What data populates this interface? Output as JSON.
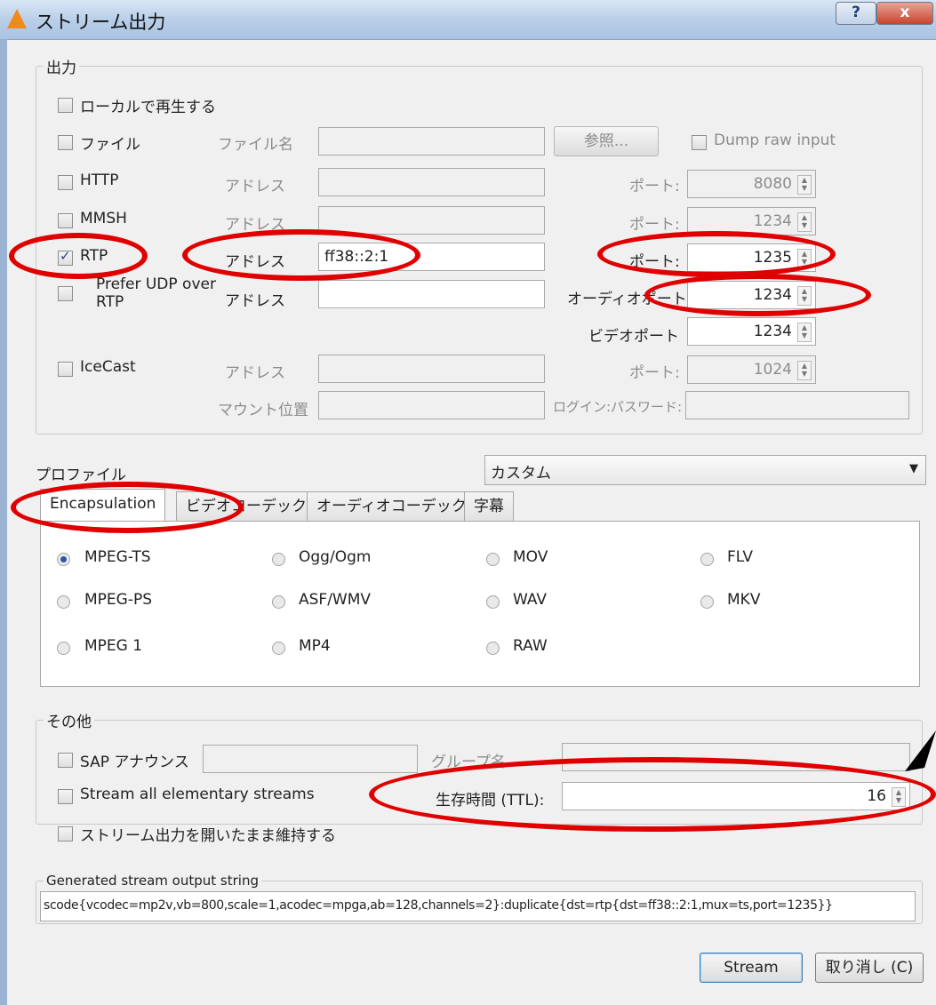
{
  "window": {
    "title": "ストリーム出力",
    "help": "?",
    "close": "x"
  },
  "output": {
    "legend": "出力",
    "local_play": "ローカルで再生する",
    "file": {
      "label": "ファイル",
      "name_label": "ファイル名",
      "name_value": "",
      "browse": "参照...",
      "dump_raw": "Dump raw input"
    },
    "http": {
      "label": "HTTP",
      "addr_label": "アドレス",
      "addr_value": "",
      "port_label": "ポート:",
      "port": "8080"
    },
    "mmsh": {
      "label": "MMSH",
      "addr_label": "アドレス",
      "addr_value": "",
      "port_label": "ポート:",
      "port": "1234"
    },
    "rtp": {
      "label": "RTP",
      "checked": true,
      "addr_label": "アドレス",
      "addr_value": "ff38::2:1",
      "port_label": "ポート:",
      "port": "1235"
    },
    "udp": {
      "label_line1": "Prefer UDP over",
      "label_line2": "RTP",
      "addr_label": "アドレス",
      "addr_value": "",
      "audio_port_label": "オーディオポート:",
      "audio_port": "1234",
      "video_port_label": "ビデオポート",
      "video_port": "1234"
    },
    "icecast": {
      "label": "IceCast",
      "addr_label": "アドレス",
      "addr_value": "",
      "port_label": "ポート:",
      "port": "1024",
      "mount_label": "マウント位置",
      "mount_value": "",
      "login_label": "ログイン:パスワード:",
      "login_value": ""
    }
  },
  "profile": {
    "label": "プロファイル",
    "selected": "カスタム"
  },
  "tabs": [
    "Encapsulation",
    "ビデオコーデック",
    "オーディオコーデック",
    "字幕"
  ],
  "formats": [
    {
      "label": "MPEG-TS",
      "selected": true
    },
    {
      "label": "Ogg/Ogm",
      "selected": false
    },
    {
      "label": "MOV",
      "selected": false
    },
    {
      "label": "FLV",
      "selected": false
    },
    {
      "label": "MPEG-PS",
      "selected": false
    },
    {
      "label": "ASF/WMV",
      "selected": false
    },
    {
      "label": "WAV",
      "selected": false
    },
    {
      "label": "MKV",
      "selected": false
    },
    {
      "label": "MPEG 1",
      "selected": false
    },
    {
      "label": "MP4",
      "selected": false
    },
    {
      "label": "RAW",
      "selected": false
    }
  ],
  "misc": {
    "legend": "その他",
    "sap": "SAP アナウンス",
    "group_label": "グループ名",
    "stream_all": "Stream all elementary streams",
    "ttl_label": "生存時間 (TTL):",
    "ttl": "16",
    "keep_open": "ストリーム出力を開いたまま維持する"
  },
  "generated": {
    "legend": "Generated stream output string",
    "value": "scode{vcodec=mp2v,vb=800,scale=1,acodec=mpga,ab=128,channels=2}:duplicate{dst=rtp{dst=ff38::2:1,mux=ts,port=1235}}"
  },
  "buttons": {
    "stream": "Stream",
    "cancel": "取り消し (C)"
  }
}
